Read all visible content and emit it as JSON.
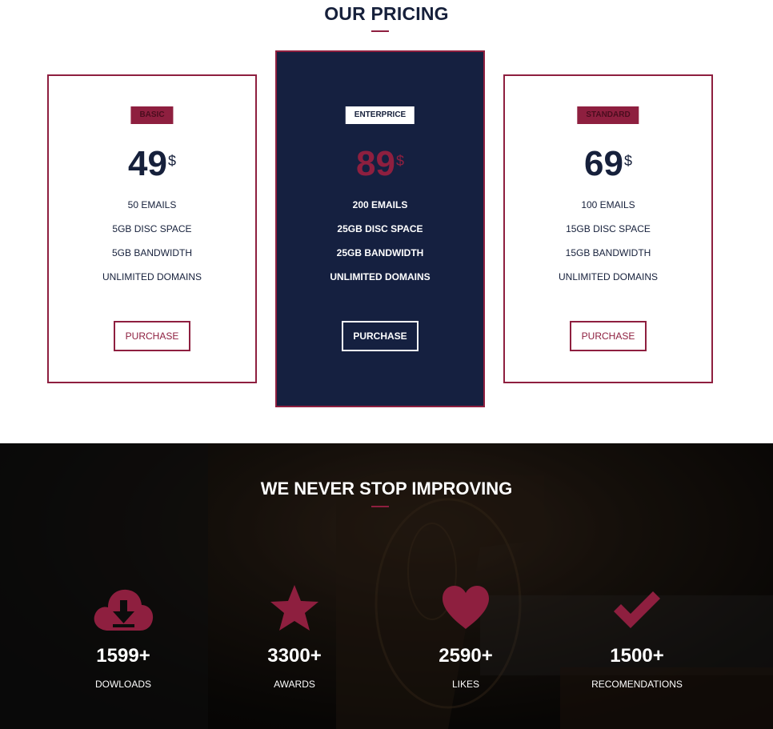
{
  "pricing": {
    "title": "OUR PRICING",
    "currency": "$",
    "purchase_label": "PURCHASE",
    "plans": [
      {
        "name": "BASIC",
        "price": "49",
        "features": [
          "50 EMAILS",
          "5GB DISC SPACE",
          "5GB BANDWIDTH",
          "UNLIMITED DOMAINS"
        ]
      },
      {
        "name": "ENTERPRICE",
        "price": "89",
        "features": [
          "200 EMAILS",
          "25GB DISC SPACE",
          "25GB BANDWIDTH",
          "UNLIMITED DOMAINS"
        ]
      },
      {
        "name": "STANDARD",
        "price": "69",
        "features": [
          "100 EMAILS",
          "15GB DISC SPACE",
          "15GB BANDWIDTH",
          "UNLIMITED DOMAINS"
        ]
      }
    ]
  },
  "stats": {
    "title": "WE NEVER STOP IMPROVING",
    "items": [
      {
        "icon": "cloud-download-icon",
        "count": "1599+",
        "label": "DOWLOADS"
      },
      {
        "icon": "star-icon",
        "count": "3300+",
        "label": "AWARDS"
      },
      {
        "icon": "heart-icon",
        "count": "2590+",
        "label": "LIKES"
      },
      {
        "icon": "check-icon",
        "count": "1500+",
        "label": "RECOMENDATIONS"
      }
    ]
  },
  "colors": {
    "navy": "#16203b",
    "accent": "#8e1f3f",
    "white": "#ffffff"
  }
}
